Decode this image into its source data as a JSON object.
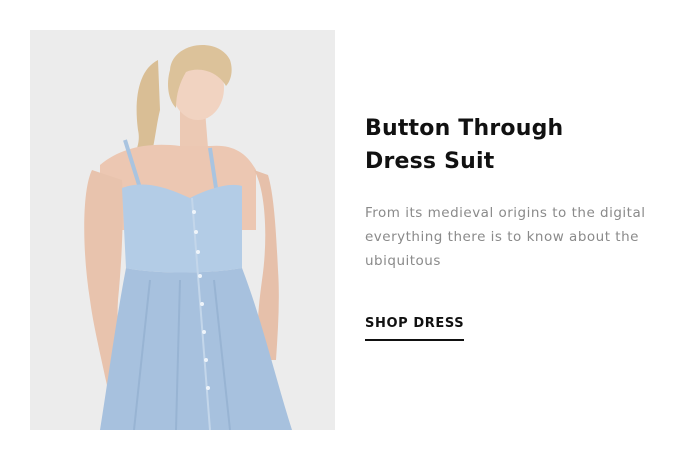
{
  "banner": {
    "title_line1": "Button Through",
    "title_line2": "Dress Suit",
    "description": "From its medieval origins to the digital everything there is to know about the ubiquitous",
    "cta_label": "SHOP DRESS"
  },
  "colors": {
    "title": "#111111",
    "description": "#8a8a8a",
    "photo_background": "#ececec",
    "dress": "#a9c4e0",
    "cta_underline": "#111111"
  }
}
